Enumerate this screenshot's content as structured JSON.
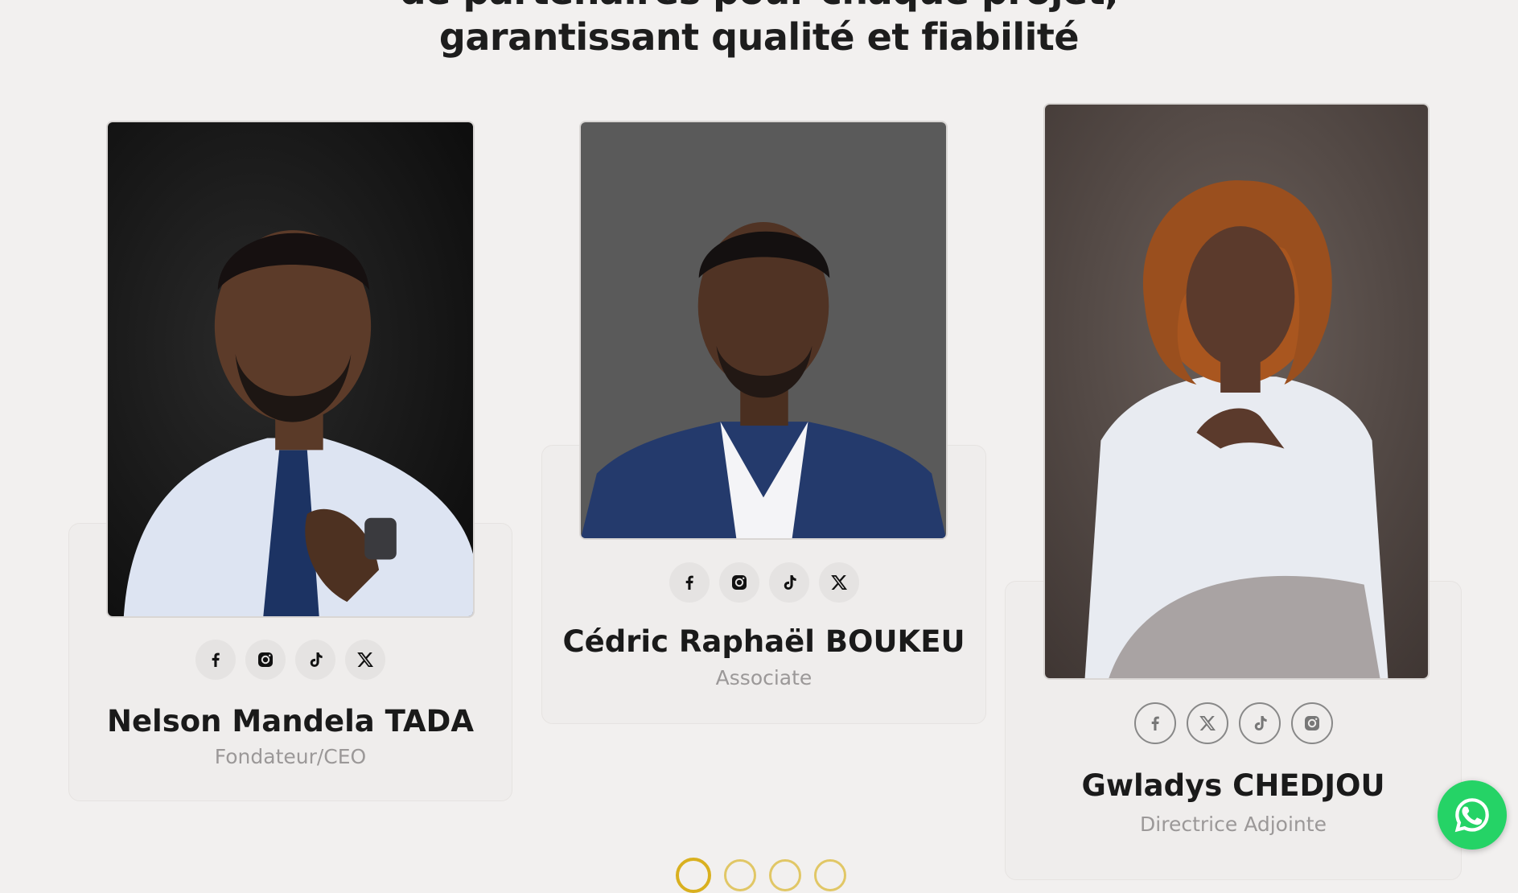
{
  "section": {
    "heading_line1": "de partenaires pour chaque projet,",
    "heading_line2": "garantissant qualité et fiabilité"
  },
  "team": [
    {
      "name": "Nelson Mandela TADA",
      "role": "Fondateur/CEO",
      "socials": [
        "facebook-icon",
        "instagram-icon",
        "tiktok-icon",
        "x-icon"
      ]
    },
    {
      "name": "Cédric Raphaël BOUKEU",
      "role": "Associate",
      "socials": [
        "facebook-icon",
        "instagram-icon",
        "tiktok-icon",
        "x-icon"
      ]
    },
    {
      "name": "Gwladys CHEDJOU",
      "role": "Directrice Adjointe",
      "socials": [
        "facebook-icon",
        "x-icon",
        "tiktok-icon",
        "instagram-icon"
      ]
    }
  ],
  "colors": {
    "background": "#f2f0ef",
    "whatsapp": "#25d366",
    "pagination": "#d9b01f"
  },
  "whatsapp_icon": "whatsapp-icon"
}
